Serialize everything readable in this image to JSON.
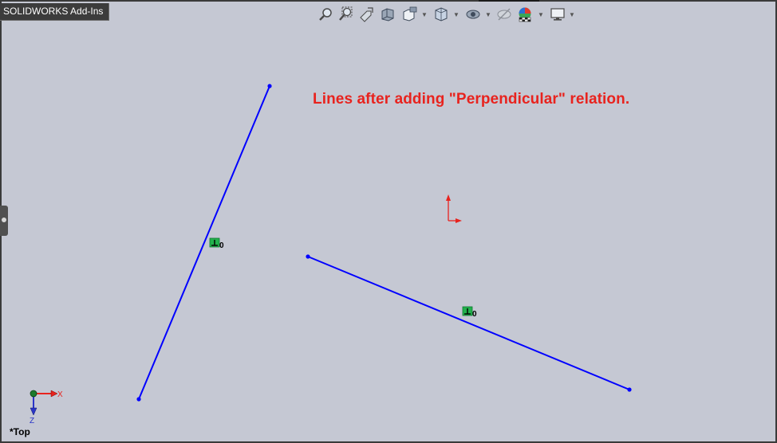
{
  "window": {
    "addins_tab_label": "SOLIDWORKS Add-Ins"
  },
  "toolbar": {
    "buttons": [
      {
        "icon": "zoom-to-fit-icon"
      },
      {
        "icon": "zoom-to-area-icon"
      },
      {
        "icon": "previous-view-icon"
      },
      {
        "icon": "section-view-icon"
      },
      {
        "icon": "dynamic-annotation-views-icon"
      },
      {
        "icon": "view-orientation-icon"
      },
      {
        "icon": "display-style-icon"
      },
      {
        "icon": "hide-show-items-icon"
      },
      {
        "icon": "edit-appearance-icon"
      },
      {
        "icon": "apply-scene-icon"
      },
      {
        "icon": "view-settings-icon"
      }
    ]
  },
  "annotation": {
    "text": "Lines after adding \"Perpendicular\" relation."
  },
  "sketch": {
    "line_color": "#0000ff",
    "relation_badge_color": "#22b14c",
    "relation_badges": [
      {
        "label": "0"
      },
      {
        "label": "0"
      }
    ]
  },
  "triad": {
    "x_label": "X",
    "z_label": "Z"
  },
  "view": {
    "name": "*Top"
  },
  "colors": {
    "viewport_background": "#c5c8d3",
    "annotation_text": "#e8231e",
    "origin_arrow": "#e8231e"
  }
}
